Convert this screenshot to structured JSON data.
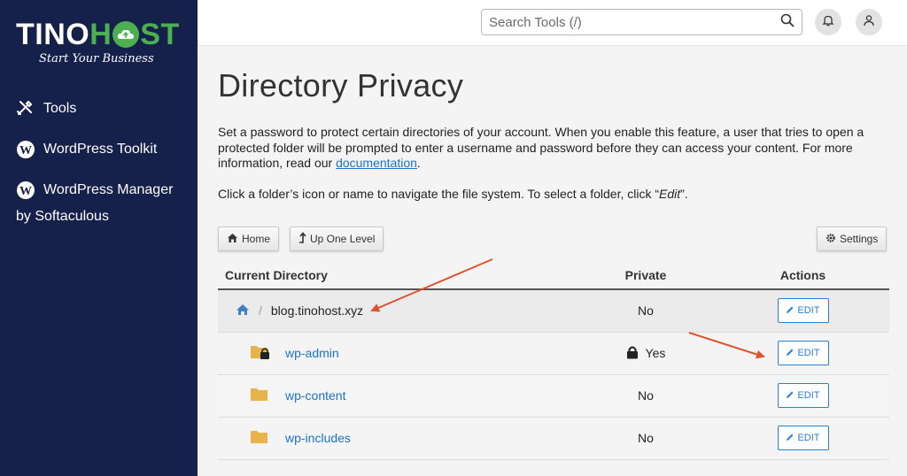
{
  "brand": {
    "name_part1": "TIN",
    "name_part1_end": "O",
    "name_part2_start": "H",
    "name_part2_end": "ST",
    "tagline": "Start Your Business",
    "accent_color": "#4caf50"
  },
  "sidebar": {
    "items": [
      {
        "label": "Tools",
        "icon": "tools-icon"
      },
      {
        "label": "WordPress Toolkit",
        "icon": "wordpress-icon"
      },
      {
        "label": "WordPress Manager",
        "sublabel": "by Softaculous",
        "icon": "wordpress-icon"
      }
    ]
  },
  "topbar": {
    "search_placeholder": "Search Tools (/)"
  },
  "page": {
    "title": "Directory Privacy",
    "description_pre": "Set a password to protect certain directories of your account. When you enable this feature, a user that tries to open a protected folder will be prompted to enter a username and password before they can access your content. For more information, read our ",
    "description_link": "documentation",
    "description_post": ".",
    "hint_pre": "Click a folder’s icon or name to navigate the file system. To select a folder, click “",
    "hint_em": "Edit",
    "hint_post": "”."
  },
  "toolbar": {
    "home_label": "Home",
    "up_label": "Up One Level",
    "settings_label": "Settings"
  },
  "table": {
    "headers": {
      "directory": "Current Directory",
      "private": "Private",
      "actions": "Actions"
    },
    "root": {
      "separator": "/",
      "name": "blog.tinohost.xyz",
      "private": "No",
      "action": "EDIT"
    },
    "rows": [
      {
        "name": "wp-admin",
        "private": "Yes",
        "locked": true,
        "action": "EDIT"
      },
      {
        "name": "wp-content",
        "private": "No",
        "locked": false,
        "action": "EDIT"
      },
      {
        "name": "wp-includes",
        "private": "No",
        "locked": false,
        "action": "EDIT"
      }
    ]
  },
  "colors": {
    "sidebar_bg": "#15204b",
    "link": "#1a73c9",
    "folder": "#e8b34a",
    "annotation_arrow": "#e0522e"
  }
}
